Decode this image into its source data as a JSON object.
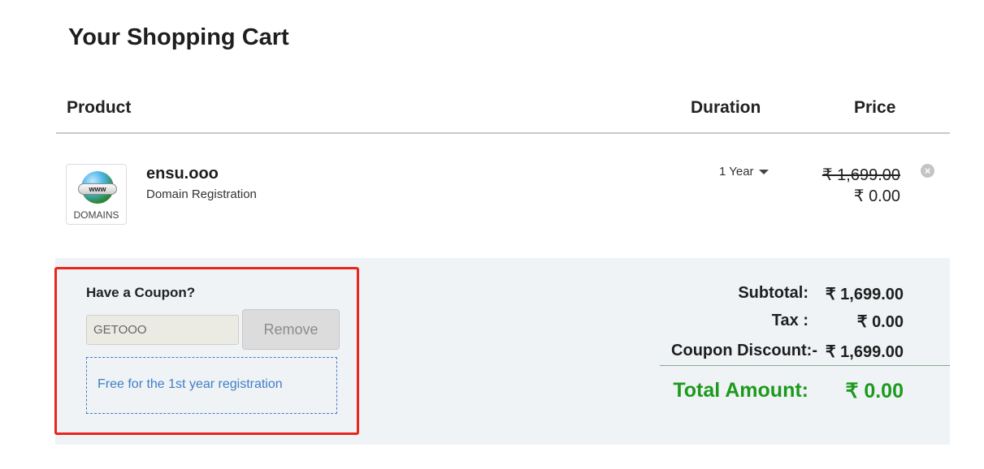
{
  "page": {
    "title": "Your Shopping Cart"
  },
  "table": {
    "headers": {
      "product": "Product",
      "duration": "Duration",
      "price": "Price"
    }
  },
  "item": {
    "thumbnail": {
      "badge": "www",
      "label": "DOMAINS",
      "icon": "globe-icon"
    },
    "name": "ensu.ooo",
    "type": "Domain Registration",
    "duration": "1 Year",
    "price_original": "₹ 1,699.00",
    "price_current": "₹ 0.00",
    "remove_icon": "close-circle-icon"
  },
  "coupon": {
    "title": "Have a Coupon?",
    "code": "GETOOO",
    "remove_label": "Remove",
    "message": "Free for the 1st year registration"
  },
  "summary": {
    "subtotal_label": "Subtotal:",
    "subtotal_value": "₹ 1,699.00",
    "tax_label": "Tax :",
    "tax_value": "₹ 0.00",
    "discount_label": "Coupon Discount:-",
    "discount_value": "₹ 1,699.00",
    "total_label": "Total Amount:",
    "total_value": "₹ 0.00"
  },
  "colors": {
    "total": "#1c9a1c",
    "highlight_border": "#e8261c",
    "link": "#3f7ec4",
    "summary_bg": "#eff3f6"
  }
}
